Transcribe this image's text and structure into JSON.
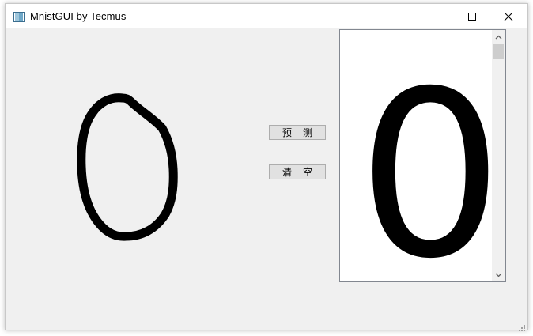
{
  "window": {
    "title": "MnistGUI by Tecmus",
    "app_icon": "window-app-icon",
    "controls": [
      "minimize-icon",
      "maximize-icon",
      "close-icon"
    ]
  },
  "drawing_canvas": {
    "stroke_color": "#000000",
    "background": "#f0f0f0"
  },
  "actions": {
    "predict_label": "预测",
    "clear_label": "清空"
  },
  "result": {
    "prediction": "0"
  },
  "colors": {
    "window_bg": "#f0f0f0",
    "titlebar_bg": "#ffffff",
    "button_bg": "#e1e1e1",
    "button_border": "#adadad",
    "view_border": "#828790"
  }
}
